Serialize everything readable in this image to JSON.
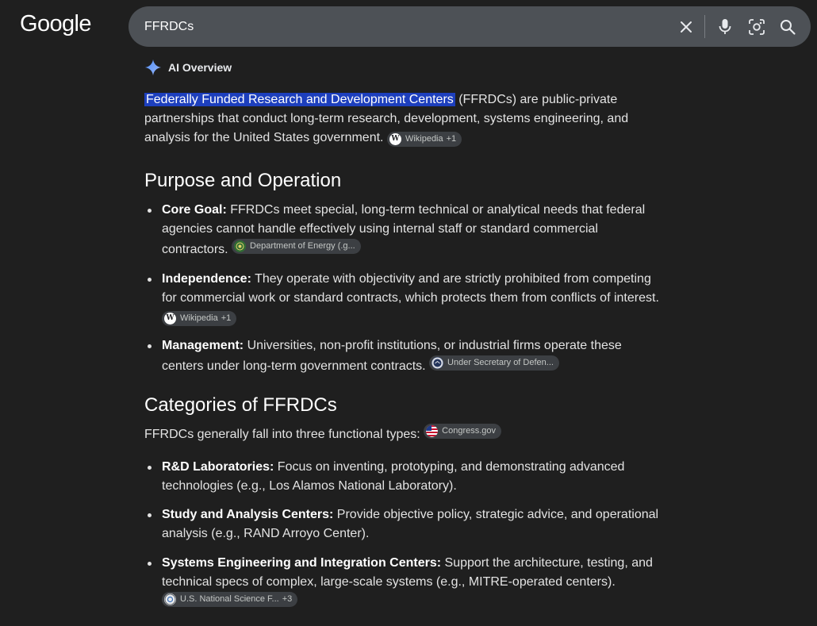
{
  "header": {
    "logo_text": "Google",
    "query": "FFRDCs",
    "icons": [
      "close-icon",
      "microphone-icon",
      "lens-icon",
      "search-icon"
    ]
  },
  "ai_overview": {
    "label": "AI Overview",
    "intro": {
      "highlight": "Federally Funded Research and Development Centers",
      "text": " (FFRDCs) are public-private partnerships that conduct long-term research, development, systems engineering, and analysis for the United States government. ",
      "chip": {
        "label": "Wikipedia",
        "more": "+1",
        "icon": "wikipedia-icon"
      }
    },
    "section1": {
      "heading": "Purpose and Operation",
      "items": [
        {
          "term": "Core Goal:",
          "text": " FFRDCs meet special, long-term technical or analytical needs that federal agencies cannot handle effectively using internal staff or standard commercial contractors. ",
          "chip": {
            "label": "Department of Energy (.g...",
            "more": "",
            "icon": "doe-seal-icon"
          }
        },
        {
          "term": "Independence:",
          "text": " They operate with objectivity and are strictly prohibited from competing for commercial work or standard contracts, which protects them from conflicts of interest. ",
          "chip": {
            "label": "Wikipedia",
            "more": "+1",
            "icon": "wikipedia-icon"
          }
        },
        {
          "term": "Management:",
          "text": " Universities, non-profit institutions, or industrial firms operate these centers under long-term government contracts. ",
          "chip": {
            "label": "Under Secretary of Defen...",
            "more": "",
            "icon": "dod-seal-icon"
          }
        }
      ]
    },
    "section2": {
      "heading": "Categories of FFRDCs",
      "intro": "FFRDCs generally fall into three functional types: ",
      "intro_chip": {
        "label": "Congress.gov",
        "more": "",
        "icon": "us-flag-icon"
      },
      "items": [
        {
          "term": "R&D Laboratories:",
          "text": " Focus on inventing, prototyping, and demonstrating advanced technologies (e.g., Los Alamos National Laboratory)."
        },
        {
          "term": "Study and Analysis Centers:",
          "text": " Provide objective policy, strategic advice, and operational analysis (e.g., RAND Arroyo Center)."
        },
        {
          "term": "Systems Engineering and Integration Centers:",
          "text": " Support the architecture, testing, and technical specs of complex, large-scale systems (e.g., MITRE-operated centers). ",
          "chip": {
            "label": "U.S. National Science F...",
            "more": "+3",
            "icon": "nsf-logo-icon"
          }
        }
      ]
    }
  },
  "colors": {
    "background": "#1f1f1f",
    "search_box": "#4d5156",
    "highlight": "#1d3fbd",
    "chip_bg": "#3c3f43"
  }
}
